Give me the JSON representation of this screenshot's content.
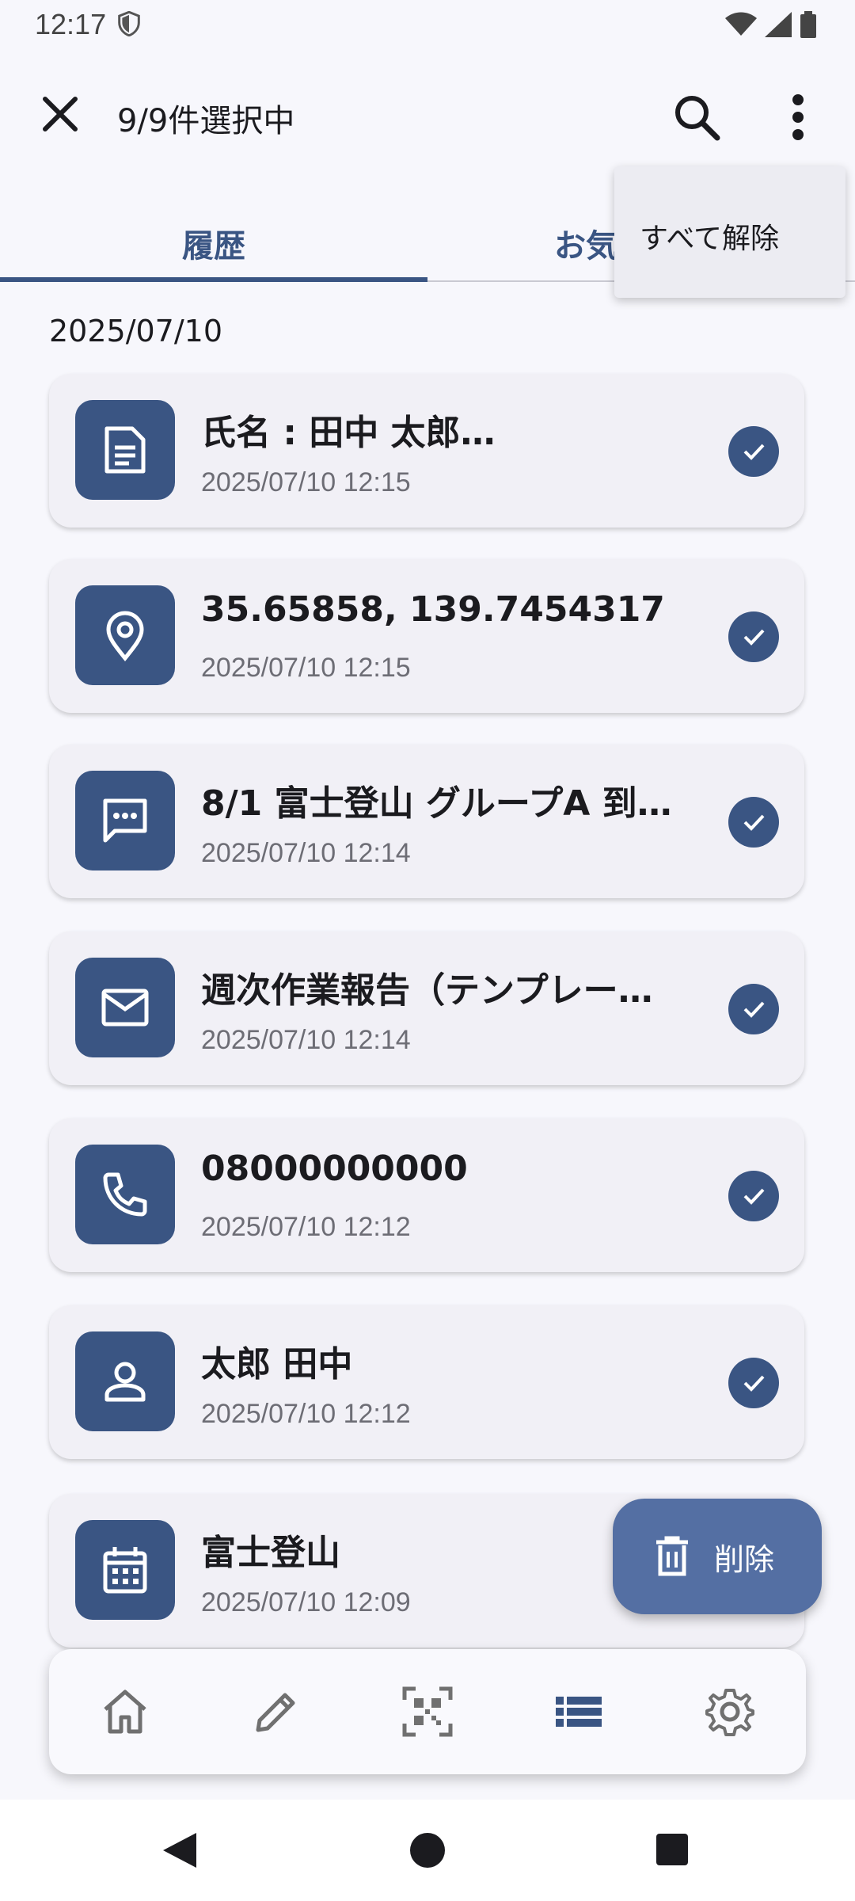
{
  "status_bar": {
    "time": "12:17"
  },
  "app_bar": {
    "title": "9/9件選択中"
  },
  "tabs": [
    {
      "label": "履歴",
      "selected": true
    },
    {
      "label": "お気",
      "selected": false
    }
  ],
  "overflow_menu": {
    "items": [
      "すべて解除"
    ]
  },
  "history": {
    "date": "2025/07/10",
    "items": [
      {
        "icon": "document-icon",
        "title": "氏名 : 田中 太郎…",
        "time": "2025/07/10 12:15",
        "checked": true
      },
      {
        "icon": "location-pin-icon",
        "title": "35.65858, 139.7454317",
        "time": "2025/07/10 12:15",
        "checked": true
      },
      {
        "icon": "message-icon",
        "title": "8/1 富士登山 グループA 到…",
        "time": "2025/07/10 12:14",
        "checked": true
      },
      {
        "icon": "mail-icon",
        "title": "週次作業報告（テンプレー…",
        "time": "2025/07/10 12:14",
        "checked": true
      },
      {
        "icon": "phone-icon",
        "title": "08000000000",
        "time": "2025/07/10 12:12",
        "checked": true
      },
      {
        "icon": "contact-icon",
        "title": "太郎 田中",
        "time": "2025/07/10 12:12",
        "checked": true
      },
      {
        "icon": "calendar-icon",
        "title": "富士登山",
        "time": "2025/07/10 12:09",
        "checked": true
      }
    ]
  },
  "fab": {
    "label": "削除",
    "icon": "trash-icon"
  },
  "bottom_nav": [
    "home-icon",
    "edit-icon",
    "qr-scan-icon",
    "list-icon",
    "settings-icon"
  ],
  "colors": {
    "accent": "#3A5583",
    "fab": "#546FA3",
    "background": "#F7F7FC",
    "card": "#F1F0F6"
  }
}
